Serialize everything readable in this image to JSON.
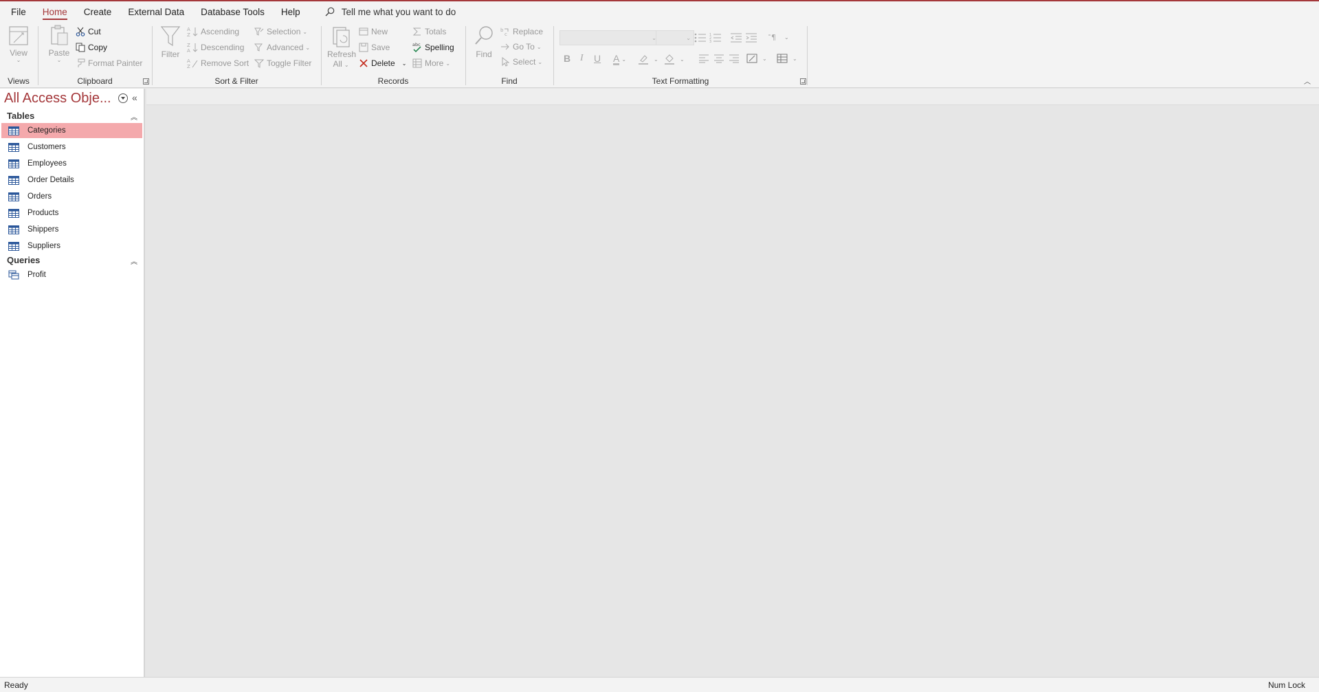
{
  "menu": {
    "tabs": [
      {
        "label": "File"
      },
      {
        "label": "Home"
      },
      {
        "label": "Create"
      },
      {
        "label": "External Data"
      },
      {
        "label": "Database Tools"
      },
      {
        "label": "Help"
      }
    ],
    "active_tab": "Home",
    "tell_me": "Tell me what you want to do"
  },
  "ribbon": {
    "views": {
      "label": "Views",
      "view": "View"
    },
    "clipboard": {
      "label": "Clipboard",
      "paste": "Paste",
      "cut": "Cut",
      "copy": "Copy",
      "format_painter": "Format Painter"
    },
    "sort_filter": {
      "label": "Sort & Filter",
      "filter": "Filter",
      "ascending": "Ascending",
      "descending": "Descending",
      "remove_sort": "Remove Sort",
      "selection": "Selection",
      "advanced": "Advanced",
      "toggle_filter": "Toggle Filter"
    },
    "records": {
      "label": "Records",
      "refresh": "Refresh",
      "refresh_all": "All",
      "new": "New",
      "save": "Save",
      "delete": "Delete",
      "totals": "Totals",
      "spelling": "Spelling",
      "more": "More"
    },
    "find": {
      "label": "Find",
      "find": "Find",
      "replace": "Replace",
      "goto": "Go To",
      "select": "Select"
    },
    "text_formatting": {
      "label": "Text Formatting",
      "bold": "B",
      "italic": "I",
      "underline": "U",
      "font_color": "A"
    }
  },
  "nav": {
    "title": "All Access Obje...",
    "sections": [
      {
        "label": "Tables",
        "items": [
          "Categories",
          "Customers",
          "Employees",
          "Order Details",
          "Orders",
          "Products",
          "Shippers",
          "Suppliers"
        ]
      },
      {
        "label": "Queries",
        "items": [
          "Profit"
        ]
      }
    ],
    "selected": "Categories"
  },
  "status": {
    "left": "Ready",
    "right": "Num Lock"
  },
  "colors": {
    "accent": "#a4373a",
    "selection": "#f4a9ac"
  }
}
